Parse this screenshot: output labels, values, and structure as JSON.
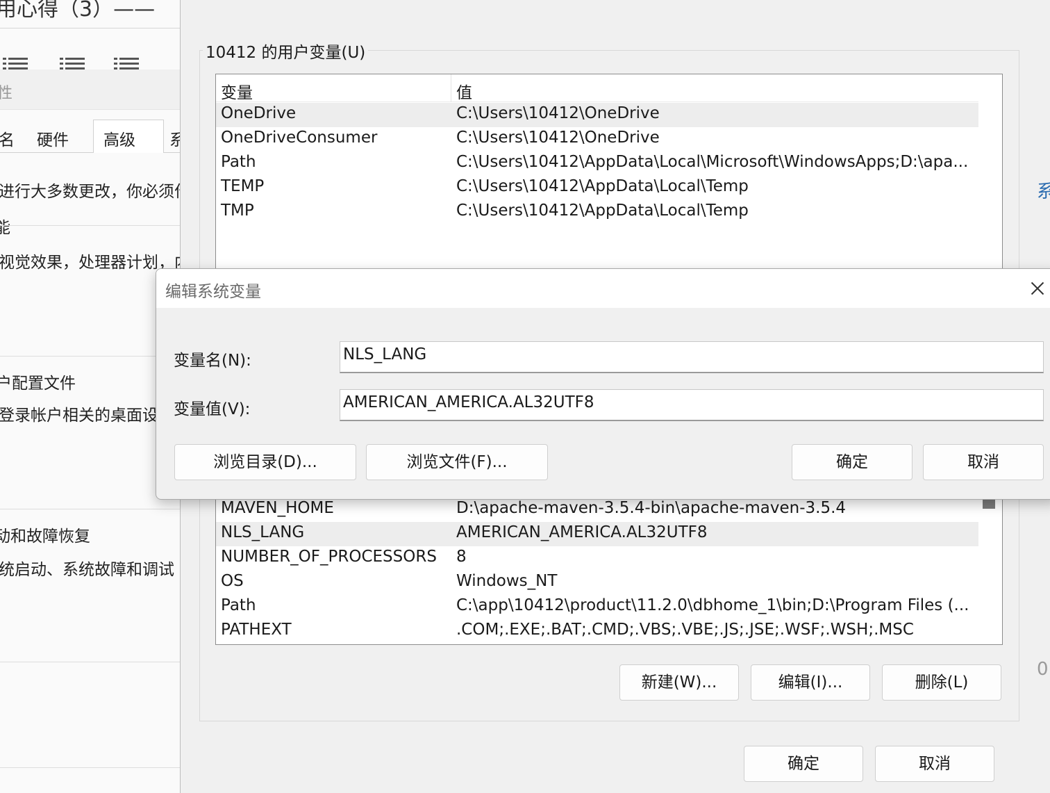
{
  "background_window": {
    "title": "用心得（3）——",
    "search_placeholder": "性",
    "tabs": [
      "计算机名",
      "硬件",
      "高级",
      "系统保护"
    ],
    "tab_visible": [
      "名",
      "硬件",
      "高级",
      "系"
    ],
    "admin_note": "进行大多数更改，你必须作",
    "perf_heading": "能",
    "perf_desc": "视觉效果，处理器计划，内",
    "profile_heading": "户配置文件",
    "profile_desc": "登录帐户相关的桌面设",
    "startup_heading": "动和故障恢复",
    "startup_desc": "统启动、系统故障和调试"
  },
  "env_dialog": {
    "user_group_label": "10412 的用户变量(U)",
    "columns": {
      "variable": "变量",
      "value": "值"
    },
    "user_vars": [
      {
        "name": "OneDrive",
        "value": "C:\\Users\\10412\\OneDrive",
        "selected": true
      },
      {
        "name": "OneDriveConsumer",
        "value": "C:\\Users\\10412\\OneDrive",
        "selected": false
      },
      {
        "name": "Path",
        "value": "C:\\Users\\10412\\AppData\\Local\\Microsoft\\WindowsApps;D:\\apa...",
        "selected": false
      },
      {
        "name": "TEMP",
        "value": "C:\\Users\\10412\\AppData\\Local\\Temp",
        "selected": false
      },
      {
        "name": "TMP",
        "value": "C:\\Users\\10412\\AppData\\Local\\Temp",
        "selected": false
      }
    ],
    "system_vars": [
      {
        "name": "MAVEN_HOME",
        "value": "D:\\apache-maven-3.5.4-bin\\apache-maven-3.5.4",
        "selected": false
      },
      {
        "name": "NLS_LANG",
        "value": "AMERICAN_AMERICA.AL32UTF8",
        "selected": true
      },
      {
        "name": "NUMBER_OF_PROCESSORS",
        "value": "8",
        "selected": false
      },
      {
        "name": "OS",
        "value": "Windows_NT",
        "selected": false
      },
      {
        "name": "Path",
        "value": "C:\\app\\10412\\product\\11.2.0\\dbhome_1\\bin;D:\\Program Files (...",
        "selected": false
      },
      {
        "name": "PATHEXT",
        "value": ".COM;.EXE;.BAT;.CMD;.VBS;.VBE;.JS;.JSE;.WSF;.WSH;.MSC",
        "selected": false
      }
    ],
    "system_buttons": {
      "new": "新建(W)...",
      "edit": "编辑(I)...",
      "delete": "删除(L)"
    },
    "ok": "确定",
    "cancel": "取消",
    "right_glyph": "系",
    "right_num": "0"
  },
  "edit_dialog": {
    "title": "编辑系统变量",
    "name_label": "变量名(N):",
    "value_label": "变量值(V):",
    "name_value": "NLS_LANG",
    "value_value": "AMERICAN_AMERICA.AL32UTF8",
    "browse_dir": "浏览目录(D)...",
    "browse_file": "浏览文件(F)...",
    "ok": "确定",
    "cancel": "取消"
  }
}
